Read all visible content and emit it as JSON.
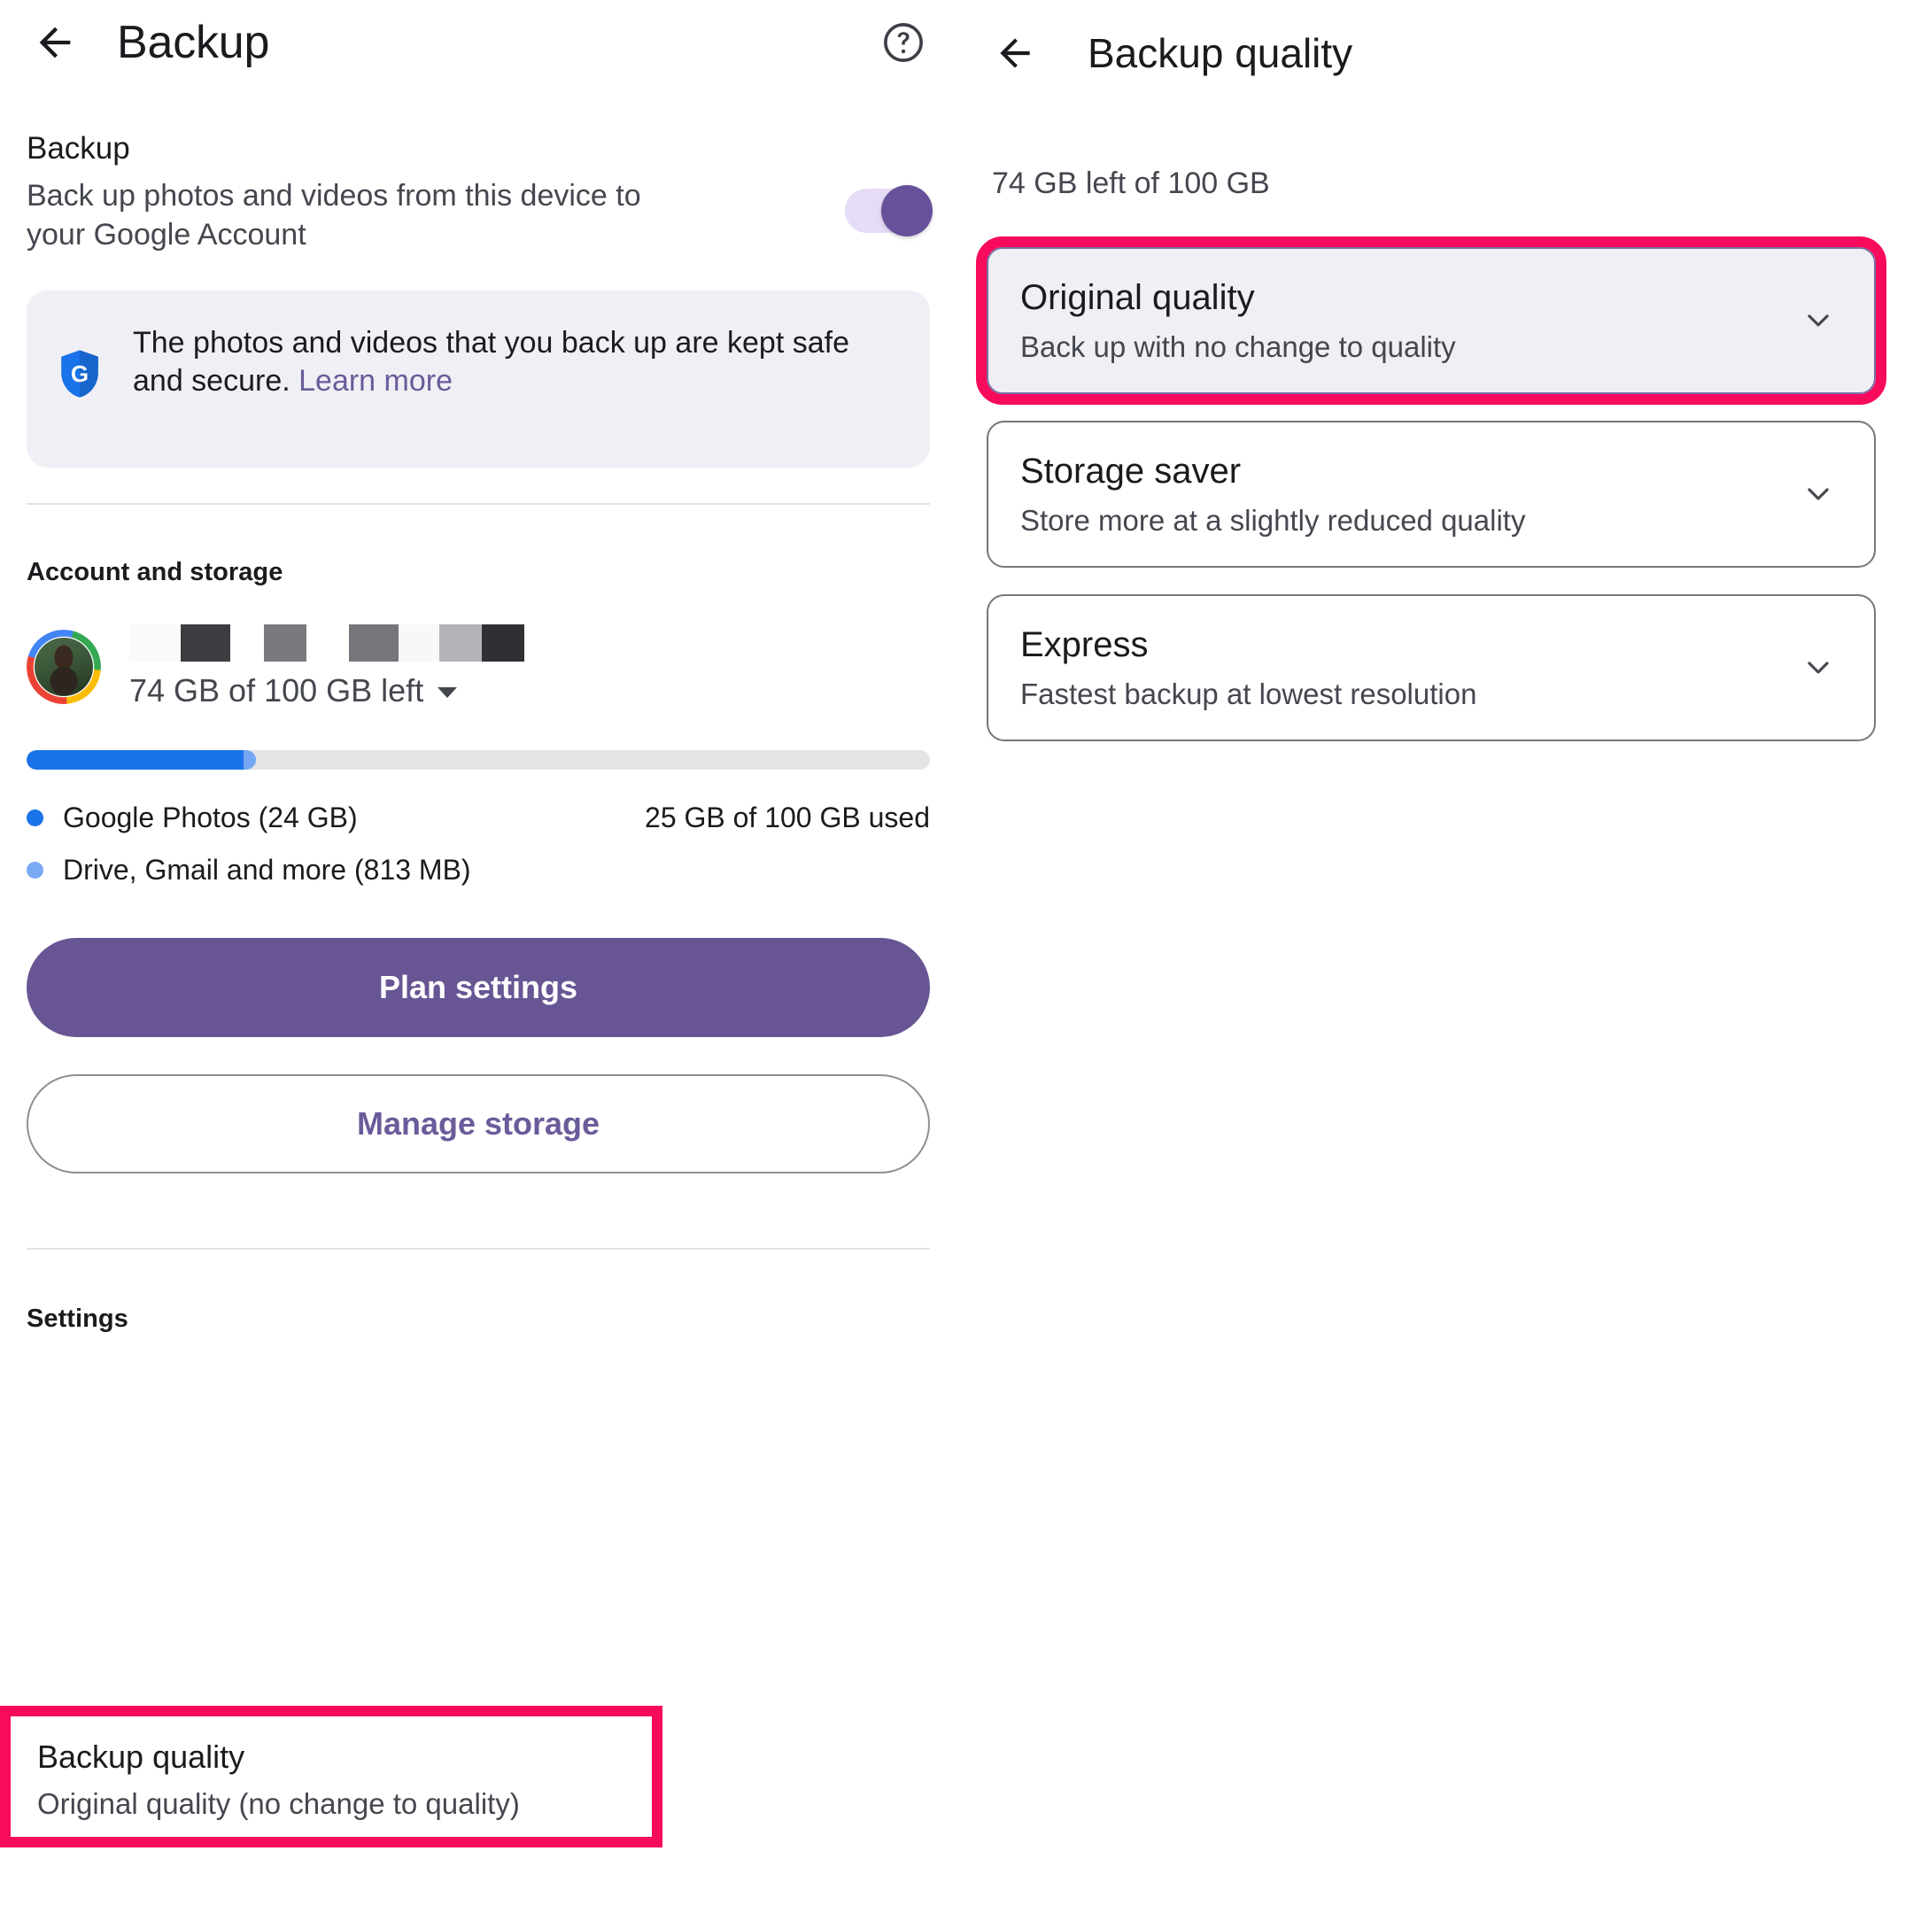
{
  "left": {
    "appbar": {
      "back_label": "Back",
      "title": "Backup",
      "help_label": "Help"
    },
    "backup_section": {
      "title": "Backup",
      "subtitle": "Back up photos and videos from this device to your Google Account",
      "toggle_state": "on"
    },
    "info_card": {
      "text": "The photos and videos that you back up are kept safe and secure. ",
      "link_text": "Learn more",
      "icon": "google-shield-icon",
      "background": "#F0EFF5"
    },
    "account_section": {
      "heading": "Account and storage",
      "email_redacted": true,
      "storage_summary": "74 GB of 100 GB left",
      "progress": {
        "used_pct": 25,
        "photos_pct": 24,
        "other_pct": 1,
        "photos_color": "#1A73E8",
        "other_color": "#74A6F3",
        "track_color": "#E4E4E6"
      },
      "legend": [
        {
          "label": "Google Photos (24 GB)",
          "color": "#1A73E8"
        },
        {
          "label": "Drive, Gmail and more (813 MB)",
          "color": "#7AA9F5"
        }
      ],
      "usage_right": "25 GB of 100 GB used",
      "plan_settings_label": "Plan settings",
      "manage_storage_label": "Manage storage"
    },
    "settings_section": {
      "heading": "Settings",
      "backup_quality": {
        "title": "Backup quality",
        "subtitle": "Original quality (no change to quality)",
        "highlighted": true
      }
    }
  },
  "right": {
    "appbar": {
      "back_label": "Back",
      "title": "Backup quality"
    },
    "quota": "74 GB left of 100 GB",
    "options": [
      {
        "title": "Original quality",
        "subtitle": "Back up with no change to quality",
        "selected": true,
        "highlighted": true,
        "chevron": "chevron-down-icon"
      },
      {
        "title": "Storage saver",
        "subtitle": "Store more at a slightly reduced quality",
        "selected": false,
        "highlighted": false,
        "chevron": "chevron-down-icon"
      },
      {
        "title": "Express",
        "subtitle": "Fastest backup at lowest resolution",
        "selected": false,
        "highlighted": false,
        "chevron": "chevron-down-icon"
      }
    ]
  },
  "colors": {
    "accent_purple": "#685594",
    "link_purple": "#6B5B9A",
    "highlight_pink": "#F80A5C",
    "toggle_track": "#E6DCF7",
    "toggle_thumb": "#66519A",
    "card_bg": "#F0EFF5",
    "text_primary": "#1B1B1F",
    "text_secondary": "#44474E"
  }
}
